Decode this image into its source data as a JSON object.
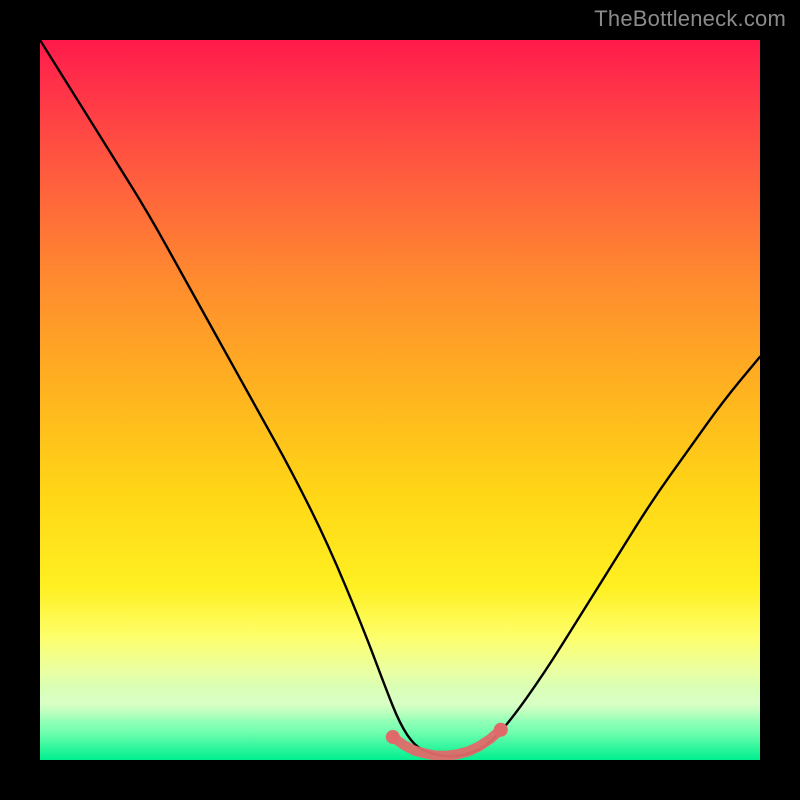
{
  "watermark": {
    "text": "TheBottleneck.com"
  },
  "chart_data": {
    "type": "line",
    "title": "",
    "xlabel": "",
    "ylabel": "",
    "xlim": [
      0,
      100
    ],
    "ylim": [
      0,
      100
    ],
    "grid": false,
    "legend": false,
    "annotations": [],
    "series": [
      {
        "name": "bottleneck-curve",
        "color": "#000000",
        "x": [
          0,
          5,
          10,
          15,
          20,
          25,
          30,
          35,
          40,
          45,
          48,
          50,
          52,
          54,
          56,
          58,
          60,
          62,
          65,
          70,
          75,
          80,
          85,
          90,
          95,
          100
        ],
        "y": [
          100,
          92,
          84,
          76,
          67,
          58,
          49,
          40,
          30,
          18,
          10,
          5,
          2,
          1,
          0.5,
          0.5,
          1,
          2,
          5,
          12,
          20,
          28,
          36,
          43,
          50,
          56
        ]
      },
      {
        "name": "highlight-dots",
        "type": "scatter",
        "color": "#e06a6a",
        "x": [
          49,
          50.5,
          52,
          53.5,
          55,
          56.5,
          58,
          59.5,
          61,
          62.5,
          64
        ],
        "y": [
          3.2,
          2.1,
          1.3,
          0.9,
          0.6,
          0.6,
          0.8,
          1.2,
          1.9,
          2.9,
          4.2
        ]
      }
    ],
    "background": "rainbow-gradient-vertical"
  }
}
